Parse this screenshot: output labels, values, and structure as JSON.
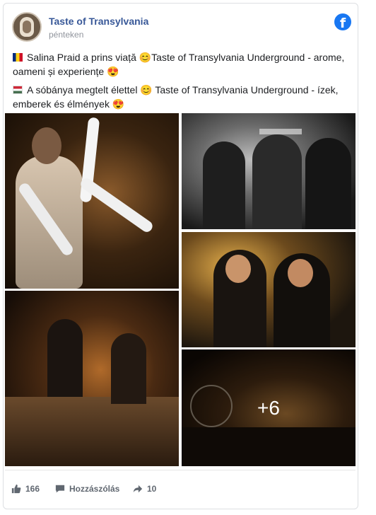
{
  "post": {
    "page_name": "Taste of Transylvania",
    "time": "pénteken",
    "text_ro": "Salina Praid a prins viață 😊Taste of Transylvania Underground - arome, oameni și experiențe 😍",
    "text_hu": "A sóbánya megtelt élettel 😊 Taste of Transylvania Underground - ízek, emberek és élmények 😍",
    "more_photos": "+6"
  },
  "footer": {
    "likes": "166",
    "comment_label": "Hozzászólás",
    "shares": "10"
  },
  "icons": {
    "facebook": "facebook-logo-icon",
    "like": "thumbs-up-icon",
    "comment": "speech-bubble-icon",
    "share": "share-arrow-icon"
  },
  "colors": {
    "page_name": "#385898",
    "facebook_blue": "#1877f2",
    "muted": "#606770"
  }
}
